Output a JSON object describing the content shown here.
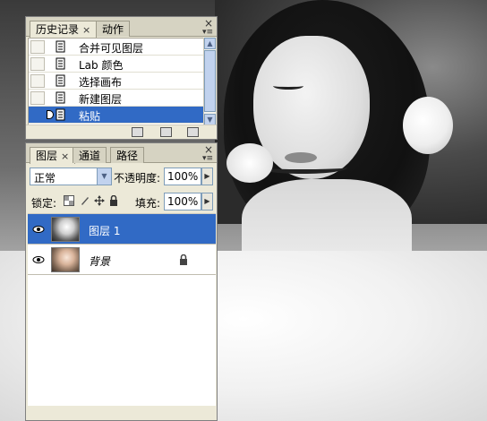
{
  "history_panel": {
    "tabs": [
      {
        "label": "历史记录",
        "close": "×",
        "active": true
      },
      {
        "label": "动作",
        "active": false
      }
    ],
    "close_glyph": "×",
    "menu_glyph": "▾≡",
    "items": [
      {
        "label": "合并可见图层",
        "selected": false
      },
      {
        "label": "Lab 颜色",
        "selected": false
      },
      {
        "label": "选择画布",
        "selected": false
      },
      {
        "label": "新建图层",
        "selected": false
      },
      {
        "label": "粘贴",
        "selected": true
      }
    ],
    "scroll_up": "▲",
    "scroll_down": "▼"
  },
  "layers_panel": {
    "tabs": [
      {
        "label": "图层",
        "close": "×",
        "active": true
      },
      {
        "label": "通道",
        "active": false
      },
      {
        "label": "路径",
        "active": false
      }
    ],
    "close_glyph": "×",
    "menu_glyph": "▾≡",
    "blend_mode": "正常",
    "opacity_label": "不透明度:",
    "opacity_value": "100%",
    "lock_label": "锁定:",
    "fill_label": "填充:",
    "fill_value": "100%",
    "dropdown_arrow": "▼",
    "step_arrow": "▶",
    "layers": [
      {
        "name": "图层 1",
        "selected": true,
        "visible": true,
        "locked": false
      },
      {
        "name": "背景",
        "selected": false,
        "visible": true,
        "locked": true
      }
    ]
  },
  "colors": {
    "selection": "#316ac5",
    "panel_bg": "#ece9d8"
  }
}
